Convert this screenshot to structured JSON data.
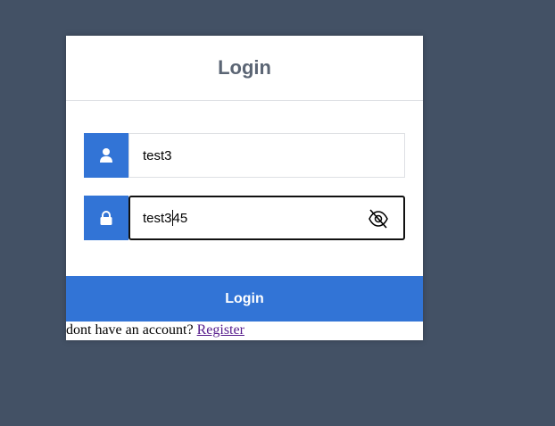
{
  "form": {
    "title": "Login",
    "username": {
      "value": "test3",
      "icon": "user-icon"
    },
    "password": {
      "value_before_caret": "test3",
      "value_after_caret": "45",
      "icon": "lock-icon",
      "toggle_icon": "eye-slash-icon"
    },
    "submit_label": "Login",
    "footer": {
      "prompt": "dont have an account? ",
      "register_label": "Register"
    }
  },
  "colors": {
    "background": "#435165",
    "accent": "#3274d6",
    "title": "#5b6574",
    "link": "#551a8b"
  }
}
